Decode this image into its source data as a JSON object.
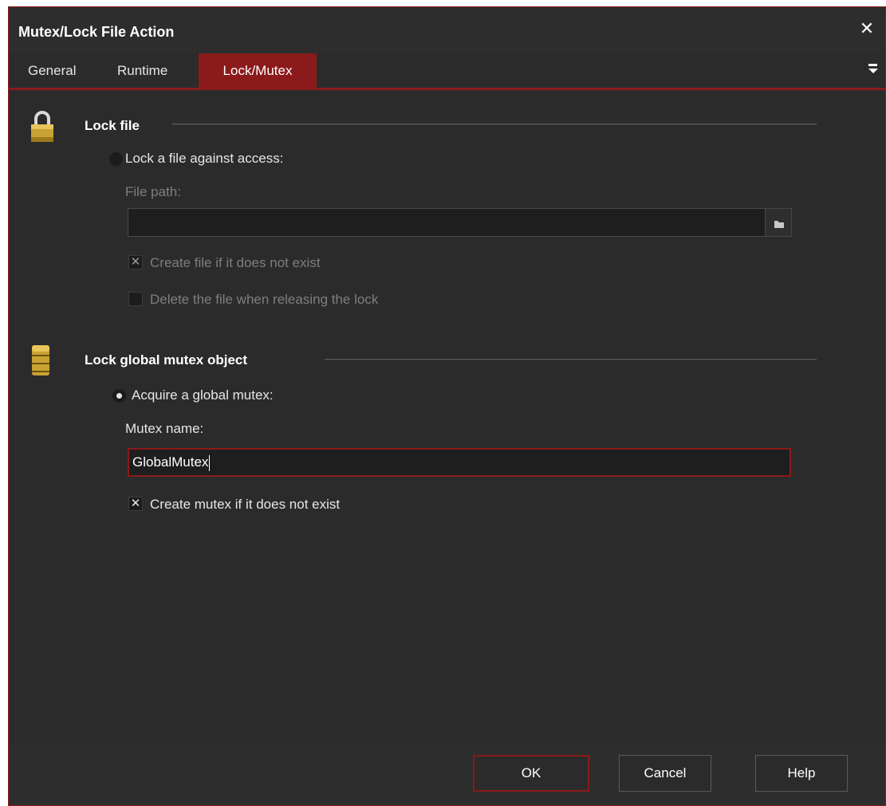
{
  "window": {
    "title": "Mutex/Lock File Action",
    "close_glyph": "✕"
  },
  "tabs": [
    {
      "label": "General"
    },
    {
      "label": "Runtime"
    },
    {
      "label": "Lock/Mutex",
      "active": true
    }
  ],
  "lock_file": {
    "heading": "Lock file",
    "icon": "padlock-icon",
    "radio_label": "Lock a file against access:",
    "radio_checked": false,
    "path_label": "File path:",
    "path_value": "",
    "create_label": "Create file if it does not exist",
    "create_checked": true,
    "delete_label": "Delete the file when releasing the lock",
    "delete_checked": false
  },
  "mutex": {
    "heading": "Lock global mutex object",
    "icon": "database-icon",
    "radio_label": "Acquire a global mutex:",
    "radio_checked": true,
    "name_label": "Mutex name:",
    "name_value": "GlobalMutex",
    "create_label": "Create mutex if it does not exist",
    "create_checked": true
  },
  "footer": {
    "ok": "OK",
    "cancel": "Cancel",
    "help": "Help"
  },
  "check_glyph": "✕",
  "colors": {
    "accent": "#8b1a1a",
    "background": "#2b2b2b",
    "text": "#e6e6e6",
    "disabled": "#7e7e7e"
  }
}
